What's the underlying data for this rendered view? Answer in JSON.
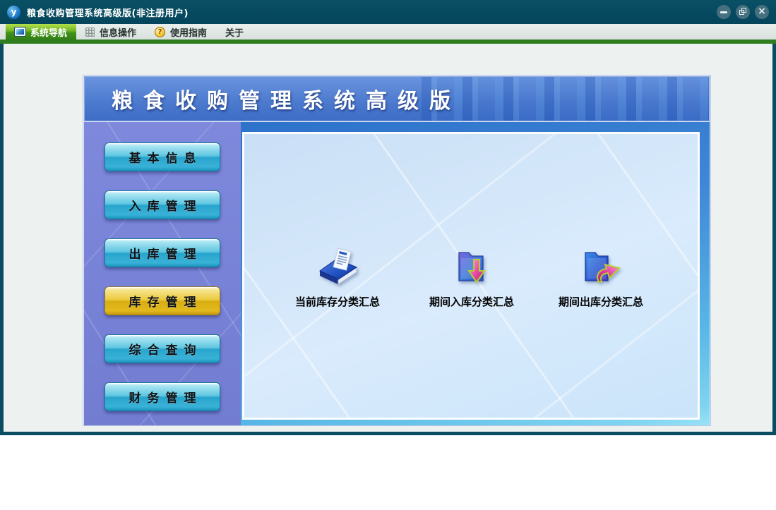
{
  "window": {
    "title": "粮食收购管理系统高级版(非注册用户)",
    "logo_text": "y",
    "controls": [
      "minimize",
      "restore",
      "close"
    ]
  },
  "menu": {
    "items": [
      {
        "label": "系统导航",
        "icon": "monitor-icon",
        "active": true
      },
      {
        "label": "信息操作",
        "icon": "grid-icon",
        "active": false
      },
      {
        "label": "使用指南",
        "icon": "help-coin-icon",
        "icon_glyph": "?",
        "active": false
      },
      {
        "label": "关于",
        "icon": null,
        "active": false
      }
    ]
  },
  "banner": {
    "title": "粮食收购管理系统高级版"
  },
  "sidebar": {
    "buttons": [
      {
        "label": "基本信息",
        "active": false
      },
      {
        "label": "入库管理",
        "active": false
      },
      {
        "label": "出库管理",
        "active": false
      },
      {
        "label": "库存管理",
        "active": true
      },
      {
        "label": "综合查询",
        "active": false
      },
      {
        "label": "财务管理",
        "active": false
      }
    ]
  },
  "content": {
    "shortcuts": [
      {
        "label": "当前库存分类汇总",
        "icon": "blue-book-icon"
      },
      {
        "label": "期间入库分类汇总",
        "icon": "folder-arrow-down-icon"
      },
      {
        "label": "期间出库分类汇总",
        "icon": "folder-arrow-out-icon"
      }
    ]
  },
  "colors": {
    "titlebar": "#05485e",
    "menubar_green_line": "#2f7d1f",
    "active_tab_green": "#5aa91e",
    "panel_banner_blue": "#4b79ce",
    "sidebar_purple": "#7b86d8",
    "button_cyan": "#3ab0d5",
    "button_active_gold": "#e3ba1f",
    "inner_panel_blue": "#d3e6fa"
  }
}
